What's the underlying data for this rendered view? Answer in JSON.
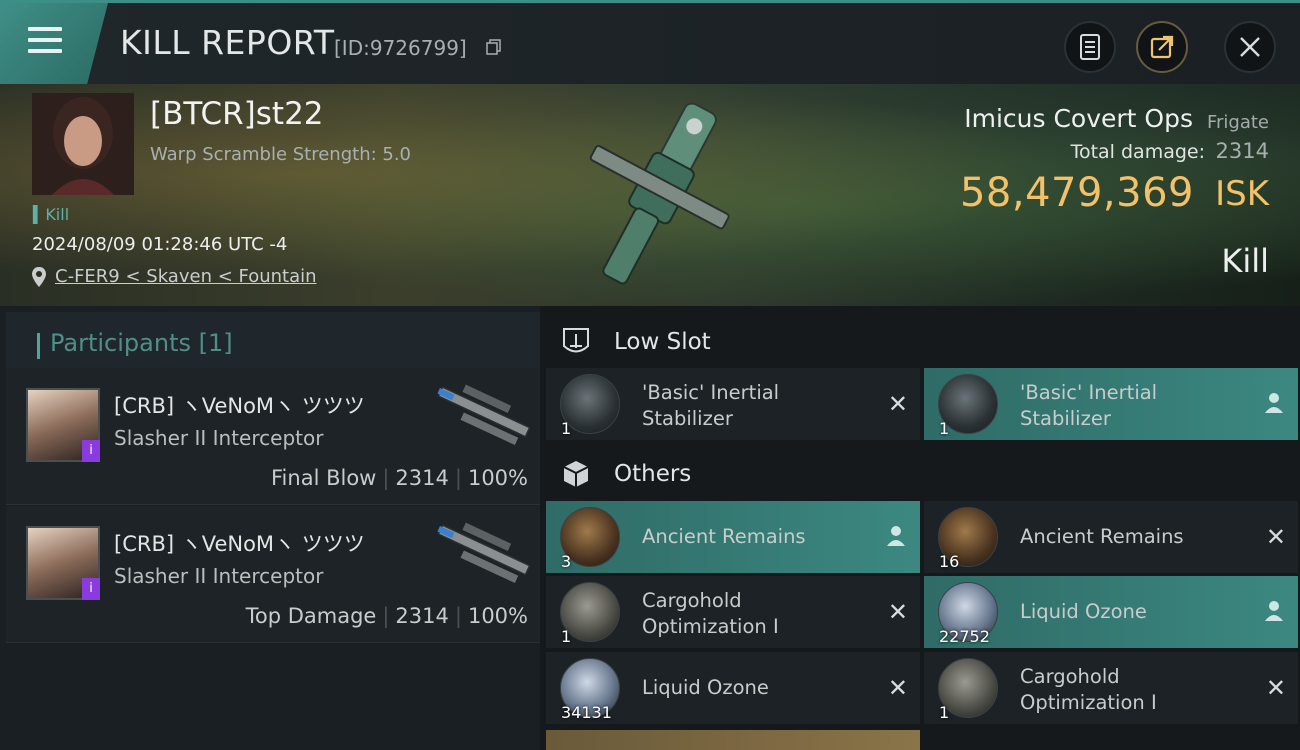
{
  "header": {
    "title": "KILL REPORT",
    "report_id": "[ID:9726799]"
  },
  "victim": {
    "name": "[BTCR]st22",
    "warp_scramble": "Warp Scramble Strength: 5.0",
    "tag": "Kill",
    "datetime": "2024/08/09 01:28:46 UTC -4",
    "location": "C-FER9 < Skaven < Fountain",
    "ship_name": "Imicus Covert Ops",
    "ship_class": "Frigate",
    "total_damage_label": "Total damage:",
    "total_damage": "2314",
    "isk_value": "58,479,369",
    "isk_unit": "ISK",
    "result": "Kill"
  },
  "participants": {
    "title": "Participants [1]",
    "rows": [
      {
        "name": "[CRB] ヽVeNoMヽ ツツツ",
        "ship": "Slasher II Interceptor",
        "role": "Final Blow",
        "damage": "2314",
        "percent": "100%",
        "badge": "i"
      },
      {
        "name": "[CRB] ヽVeNoMヽ ツツツ",
        "ship": "Slasher II Interceptor",
        "role": "Top Damage",
        "damage": "2314",
        "percent": "100%",
        "badge": "i"
      }
    ]
  },
  "sections": {
    "low_slot": "Low Slot",
    "others": "Others"
  },
  "items": {
    "low_1": {
      "name": "'Basic' Inertial Stabilizer",
      "qty": "1"
    },
    "low_2": {
      "name": "'Basic' Inertial Stabilizer",
      "qty": "1"
    },
    "o1": {
      "name": "Ancient Remains",
      "qty": "3"
    },
    "o2": {
      "name": "Ancient Remains",
      "qty": "16"
    },
    "o3": {
      "name": "Cargohold Optimization I",
      "qty": "1"
    },
    "o4": {
      "name": "Liquid Ozone",
      "qty": "22752"
    },
    "o5": {
      "name": "Liquid Ozone",
      "qty": "34131"
    },
    "o6": {
      "name": "Cargohold Optimization I",
      "qty": "1"
    }
  },
  "colors": {
    "accent": "#3c8881",
    "isk": "#f2c16a",
    "badge": "#8a3be0"
  }
}
